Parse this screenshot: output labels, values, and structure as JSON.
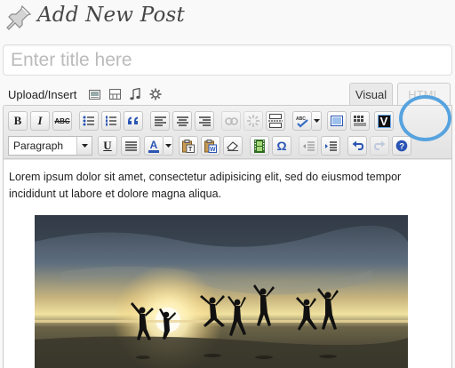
{
  "page": {
    "title": "Add New Post"
  },
  "title_field": {
    "placeholder": "Enter title here",
    "value": ""
  },
  "media": {
    "label": "Upload/Insert",
    "buttons": [
      "image-icon",
      "video-icon",
      "audio-icon",
      "media-gear-icon"
    ]
  },
  "tabs": {
    "visual": "Visual",
    "html": "HTML"
  },
  "toolbar": {
    "row1": [
      "bold",
      "italic",
      "strikethrough",
      "bullet-list",
      "numbered-list",
      "blockquote",
      "align-left",
      "align-center",
      "align-right",
      "insert-link",
      "unlink",
      "more-tag",
      "spellcheck",
      "fullscreen",
      "kitchen-sink",
      "v-plugin"
    ],
    "row2": [
      "format-select",
      "underline",
      "justify",
      "text-color",
      "paste-text",
      "paste-word",
      "clear-formatting",
      "insert-media",
      "special-char",
      "outdent",
      "indent",
      "undo",
      "redo",
      "help"
    ],
    "bold_label": "B",
    "italic_label": "I",
    "strike_label": "ABC",
    "underline_label": "U",
    "omega_label": "Ω",
    "textcolor_label": "A",
    "format_value": "Paragraph",
    "vplugin_label": "V",
    "highlight_color": "#57a3df"
  },
  "content": {
    "text": "Lorem ipsum dolor sit amet, consectetur adipisicing elit, sed do eiusmod tempor incididunt ut labore et dolore magna aliqua.",
    "image": "sunset-beach-jumping-people"
  }
}
